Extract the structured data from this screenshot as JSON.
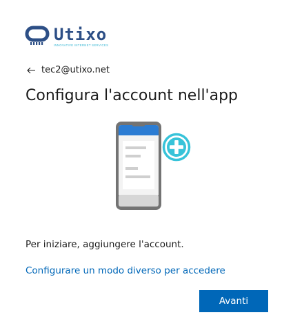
{
  "brand": {
    "name": "Utixo",
    "tagline": "INNOVATIVE INTERNET SERVICES",
    "primary_color": "#2d4f86",
    "accent_color": "#37b6d3"
  },
  "identity": {
    "back_icon": "arrow-left-icon",
    "email": "tec2@utixo.net"
  },
  "title": "Configura l'account nell'app",
  "illustration": {
    "icon": "phone-add-account-icon"
  },
  "instruction": "Per iniziare, aggiungere l'account.",
  "alt_link": "Configurare un modo diverso per accedere",
  "next_button": "Avanti",
  "colors": {
    "link": "#0067b8",
    "button": "#0067b8",
    "button_text": "#ffffff"
  }
}
